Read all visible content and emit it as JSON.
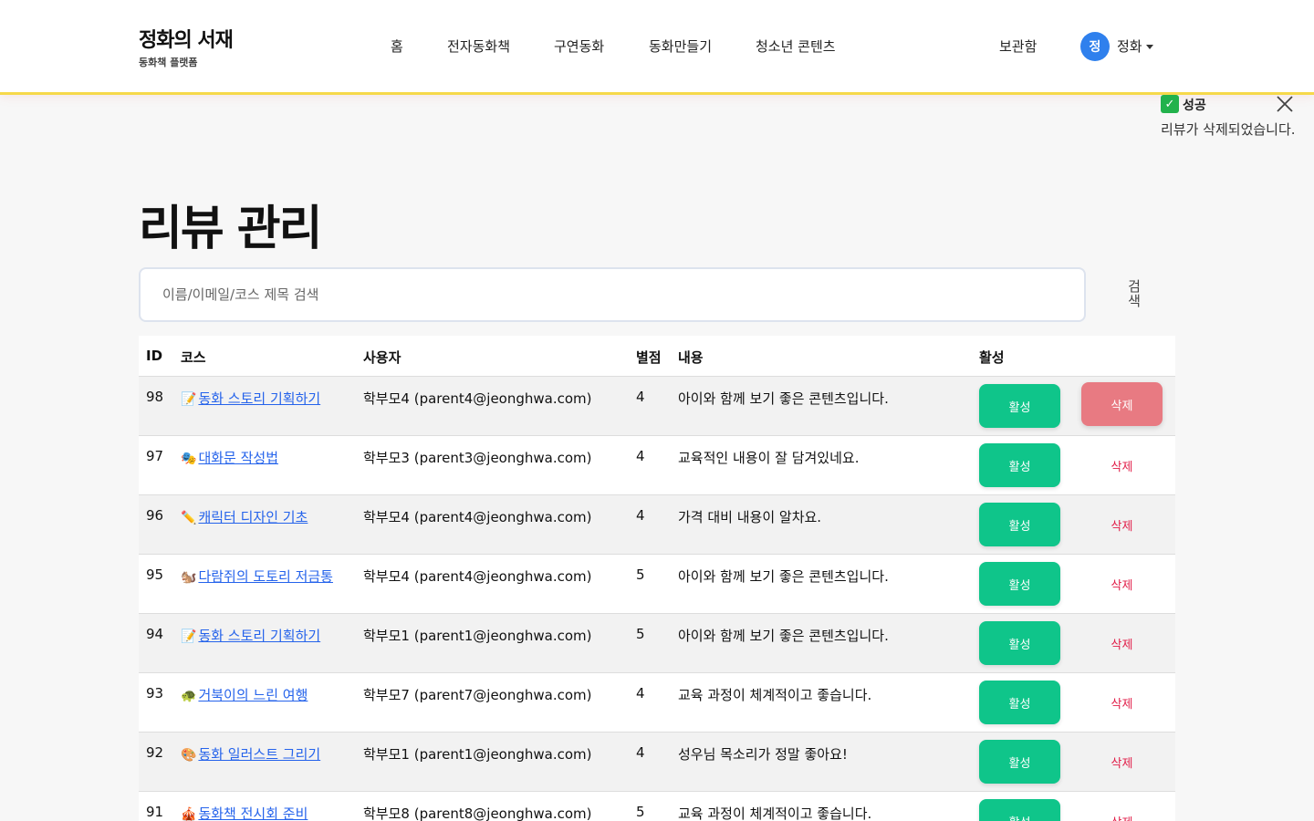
{
  "header": {
    "logo_title": "정화의 서재",
    "logo_subtitle": "동화책 플랫폼",
    "nav": [
      "홈",
      "전자동화책",
      "구연동화",
      "동화만들기",
      "청소년 콘텐츠"
    ],
    "storage": "보관함",
    "avatar_initial": "정",
    "user_name": "정화"
  },
  "toast": {
    "icon": "check-icon",
    "title": "성공",
    "message": "리뷰가 삭제되었습니다."
  },
  "page": {
    "title": "리뷰 관리"
  },
  "search": {
    "placeholder": "이름/이메일/코스 제목 검색",
    "value": "",
    "button": "검\n색"
  },
  "table": {
    "headers": {
      "id": "ID",
      "course": "코스",
      "user": "사용자",
      "rating": "별점",
      "content": "내용",
      "active": "활성"
    },
    "rows": [
      {
        "id": "98",
        "emoji": "📝",
        "course": "동화 스토리 기획하기",
        "user": "학부모4 (parent4@jeonghwa.com)",
        "rating": "4",
        "content": "아이와 함께 보기 좋은 콘텐츠입니다.",
        "active_label": "활성",
        "delete_label": "삭제"
      },
      {
        "id": "97",
        "emoji": "🎭",
        "course": "대화문 작성법",
        "user": "학부모3 (parent3@jeonghwa.com)",
        "rating": "4",
        "content": "교육적인 내용이 잘 담겨있네요.",
        "active_label": "활성",
        "delete_label": "삭제"
      },
      {
        "id": "96",
        "emoji": "✏️",
        "course": "캐릭터 디자인 기초",
        "user": "학부모4 (parent4@jeonghwa.com)",
        "rating": "4",
        "content": "가격 대비 내용이 알차요.",
        "active_label": "활성",
        "delete_label": "삭제"
      },
      {
        "id": "95",
        "emoji": "🐿️",
        "course": "다람쥐의 도토리 저금통",
        "user": "학부모4 (parent4@jeonghwa.com)",
        "rating": "5",
        "content": "아이와 함께 보기 좋은 콘텐츠입니다.",
        "active_label": "활성",
        "delete_label": "삭제"
      },
      {
        "id": "94",
        "emoji": "📝",
        "course": "동화 스토리 기획하기",
        "user": "학부모1 (parent1@jeonghwa.com)",
        "rating": "5",
        "content": "아이와 함께 보기 좋은 콘텐츠입니다.",
        "active_label": "활성",
        "delete_label": "삭제"
      },
      {
        "id": "93",
        "emoji": "🐢",
        "course": "거북이의 느린 여행",
        "user": "학부모7 (parent7@jeonghwa.com)",
        "rating": "4",
        "content": "교육 과정이 체계적이고 좋습니다.",
        "active_label": "활성",
        "delete_label": "삭제"
      },
      {
        "id": "92",
        "emoji": "🎨",
        "course": "동화 일러스트 그리기",
        "user": "학부모1 (parent1@jeonghwa.com)",
        "rating": "4",
        "content": "성우님 목소리가 정말 좋아요!",
        "active_label": "활성",
        "delete_label": "삭제"
      },
      {
        "id": "91",
        "emoji": "🎪",
        "course": "동화책 전시회 준비",
        "user": "학부모8 (parent8@jeonghwa.com)",
        "rating": "5",
        "content": "교육 과정이 체계적이고 좋습니다.",
        "active_label": "활성",
        "delete_label": "삭제"
      }
    ]
  },
  "colors": {
    "accent_border": "#f6d94a",
    "active_button": "#0fc58a",
    "delete_text": "#e11d48",
    "delete_hover_bg": "#e87a82",
    "link": "#2563eb",
    "avatar": "#2f80ed"
  }
}
